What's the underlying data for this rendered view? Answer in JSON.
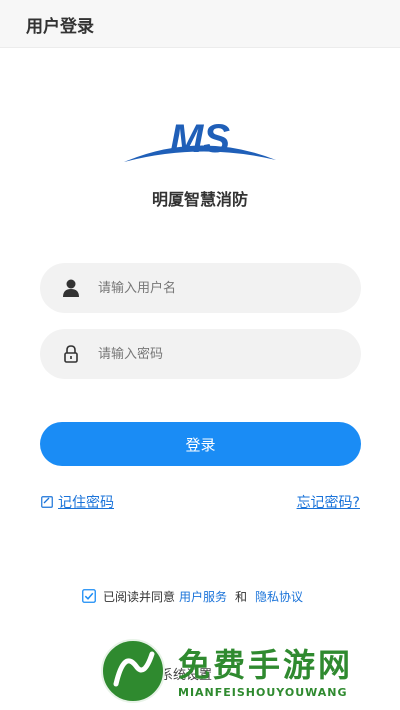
{
  "header": {
    "title": "用户登录"
  },
  "brand": {
    "logo_text": "MS",
    "app_name": "明厦智慧消防",
    "color": "#1f5fb8"
  },
  "form": {
    "username_placeholder": "请输入用户名",
    "password_placeholder": "请输入密码",
    "login_label": "登录",
    "remember_label": "记住密码",
    "forgot_label": "忘记密码?"
  },
  "agreement": {
    "prefix": "已阅读并同意",
    "service_link": "用户服务",
    "and": "和",
    "privacy_link": "隐私协议",
    "checked": true
  },
  "footer": {
    "settings_label": "系统设置"
  },
  "watermark": {
    "title": "免费手游网",
    "subtitle": "MIANFEISHOUYOUWANG",
    "color": "#2f8a2f"
  },
  "colors": {
    "accent": "#1a8cf5",
    "link": "#1a73d9",
    "field_bg": "#f2f2f2"
  }
}
